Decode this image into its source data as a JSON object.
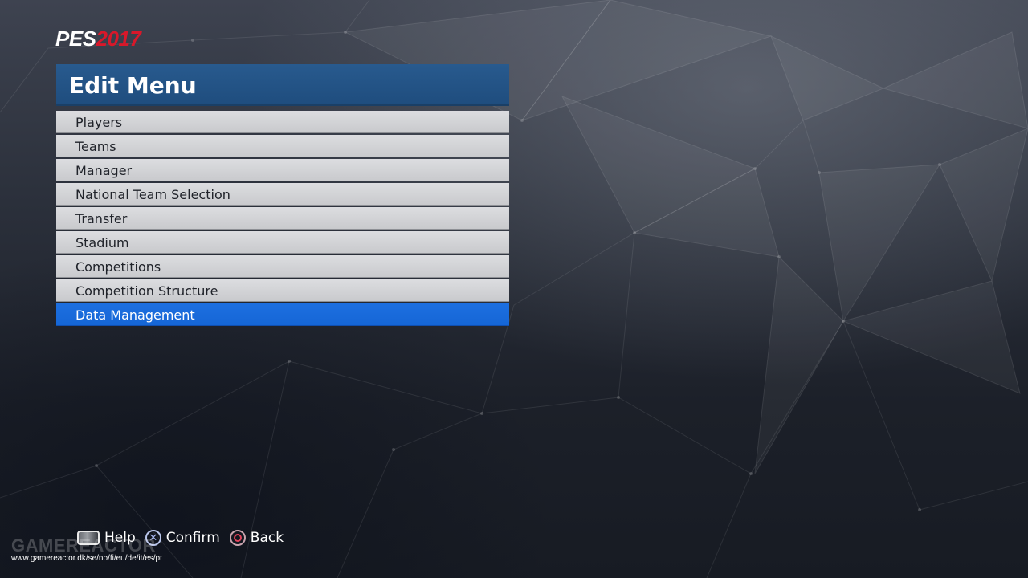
{
  "logo": {
    "pes": "PES",
    "year": "2017"
  },
  "panel": {
    "title": "Edit Menu"
  },
  "menu": {
    "items": [
      {
        "label": "Players"
      },
      {
        "label": "Teams"
      },
      {
        "label": "Manager"
      },
      {
        "label": "National Team Selection"
      },
      {
        "label": "Transfer"
      },
      {
        "label": "Stadium"
      },
      {
        "label": "Competitions"
      },
      {
        "label": "Competition Structure"
      },
      {
        "label": "Data Management"
      }
    ],
    "selected_index": 8
  },
  "footer": {
    "help_label": "Help",
    "help_icon": "touchpad-icon",
    "confirm_label": "Confirm",
    "confirm_icon": "cross-button-icon",
    "back_label": "Back",
    "back_icon": "circle-button-icon"
  },
  "watermark": {
    "brand": "GAMEREACTOR",
    "url": "www.gamereactor.dk/se/no/fi/eu/de/it/es/pt"
  },
  "colors": {
    "accent_selected": "#1a6ddd",
    "title_bar": "#245487",
    "logo_year": "#d8182a"
  }
}
